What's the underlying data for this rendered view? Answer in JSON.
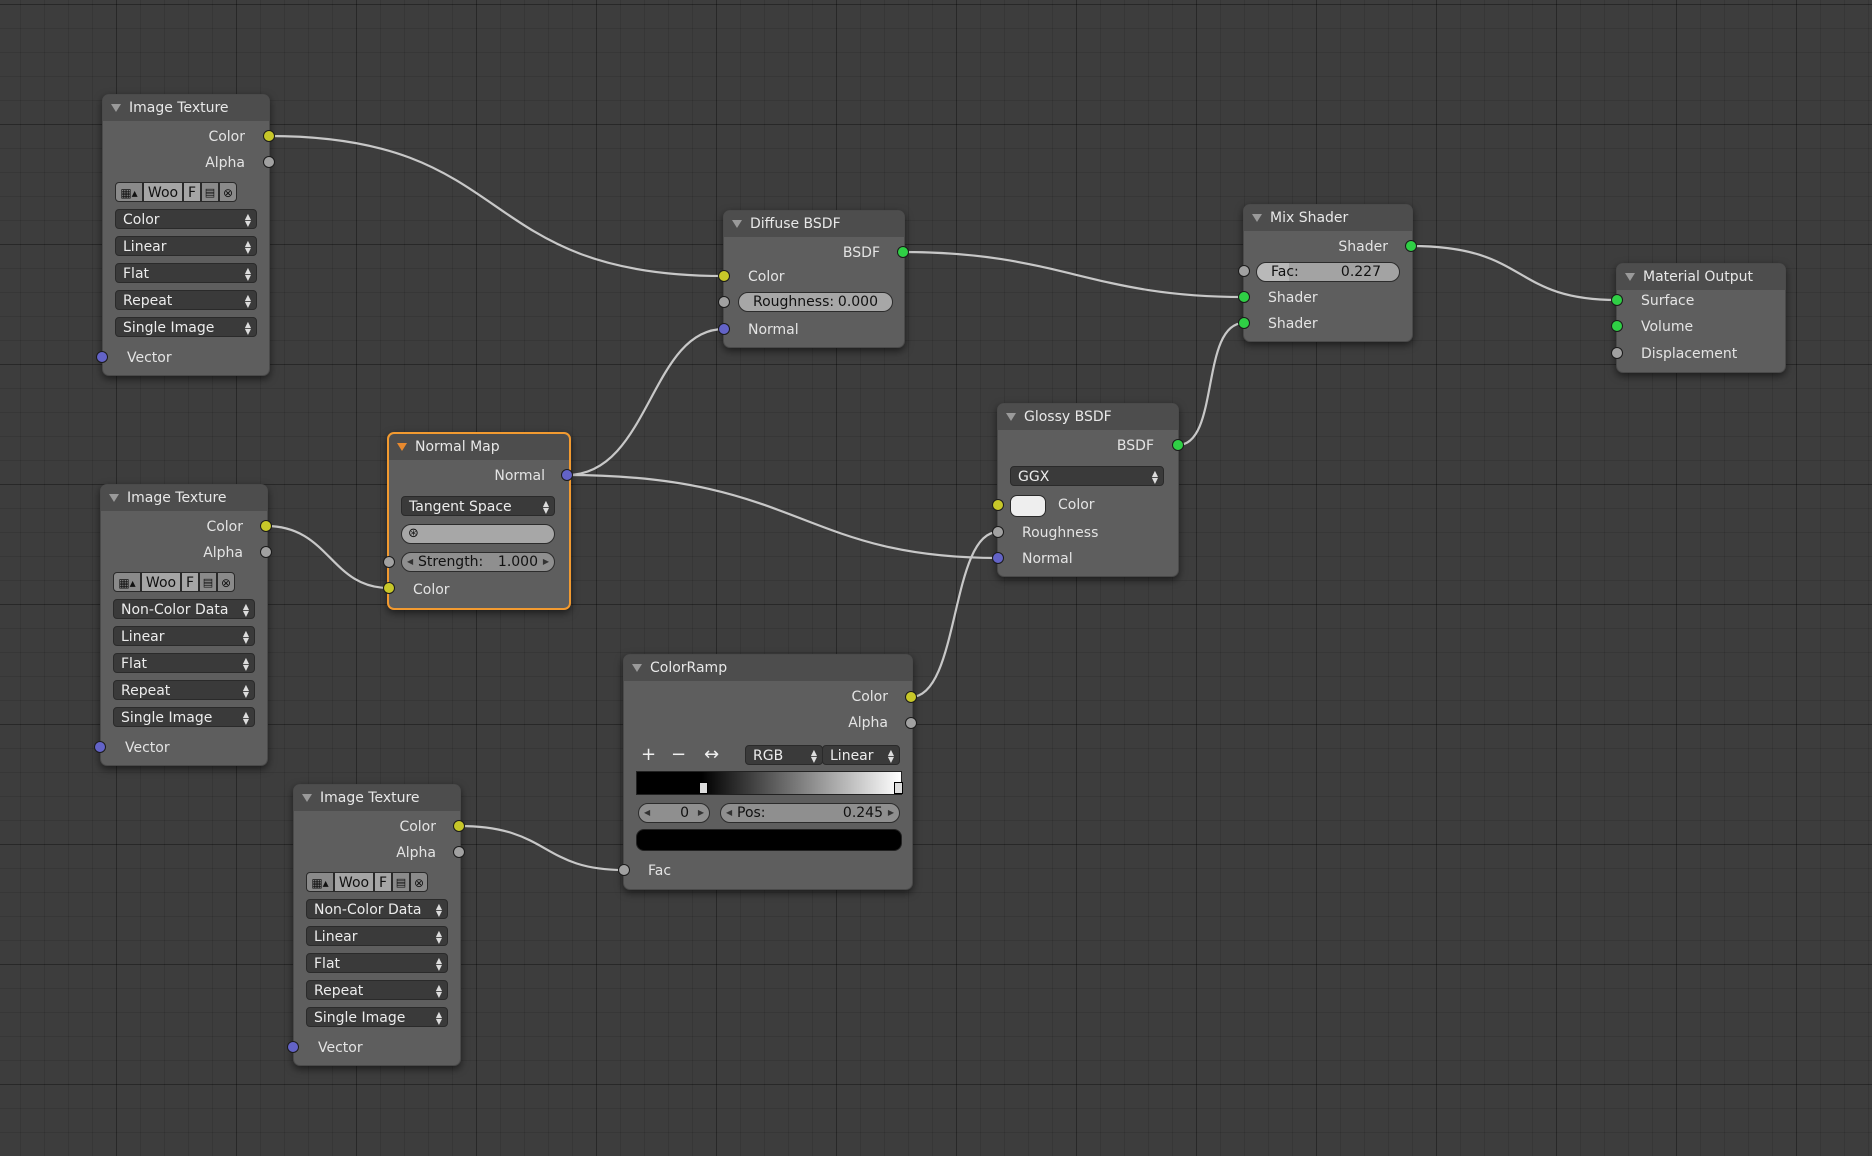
{
  "editor": "node-editor",
  "nodes": {
    "img1": {
      "title": "Image Texture",
      "outputs": [
        "Color",
        "Alpha"
      ],
      "image": {
        "name": "Woo",
        "fake_user": "F",
        "icon": "image-browse-icon"
      },
      "color_space": "Color",
      "interpolation": "Linear",
      "projection": "Flat",
      "extension": "Repeat",
      "source": "Single Image",
      "inputs": [
        "Vector"
      ]
    },
    "img2": {
      "title": "Image Texture",
      "outputs": [
        "Color",
        "Alpha"
      ],
      "image": {
        "name": "Woo",
        "fake_user": "F"
      },
      "color_space": "Non-Color Data",
      "interpolation": "Linear",
      "projection": "Flat",
      "extension": "Repeat",
      "source": "Single Image",
      "inputs": [
        "Vector"
      ]
    },
    "img3": {
      "title": "Image Texture",
      "outputs": [
        "Color",
        "Alpha"
      ],
      "image": {
        "name": "Woo",
        "fake_user": "F"
      },
      "color_space": "Non-Color Data",
      "interpolation": "Linear",
      "projection": "Flat",
      "extension": "Repeat",
      "source": "Single Image",
      "inputs": [
        "Vector"
      ]
    },
    "normal_map": {
      "title": "Normal Map",
      "outputs": [
        "Normal"
      ],
      "space": "Tangent Space",
      "strength_label": "Strength:",
      "strength": "1.000",
      "inputs": [
        "Color"
      ],
      "active": true
    },
    "diffuse": {
      "title": "Diffuse BSDF",
      "outputs": [
        "BSDF"
      ],
      "inputs": [
        "Color",
        "Normal"
      ],
      "roughness_label": "Roughness:",
      "roughness": "0.000"
    },
    "glossy": {
      "title": "Glossy BSDF",
      "outputs": [
        "BSDF"
      ],
      "distribution": "GGX",
      "inputs": [
        "Color",
        "Roughness",
        "Normal"
      ],
      "color_swatch": "#eeeeee"
    },
    "mix": {
      "title": "Mix Shader",
      "outputs": [
        "Shader"
      ],
      "fac_label": "Fac:",
      "fac": "0.227",
      "inputs": [
        "Shader",
        "Shader"
      ]
    },
    "output": {
      "title": "Material Output",
      "inputs": [
        "Surface",
        "Volume",
        "Displacement"
      ]
    },
    "colorramp": {
      "title": "ColorRamp",
      "outputs": [
        "Color",
        "Alpha"
      ],
      "add": "+",
      "remove": "−",
      "flip": "↔",
      "color_mode": "RGB",
      "interpolation": "Linear",
      "active_stop": "0",
      "pos_label": "Pos:",
      "pos": "0.245",
      "stop_color": "#000000",
      "inputs": [
        "Fac"
      ]
    }
  },
  "socket_colors": {
    "color": "#c7c729",
    "float": "#a1a1a1",
    "vector": "#6363c7",
    "shader": "#2fcf45"
  },
  "active_outline": "#f29a30"
}
